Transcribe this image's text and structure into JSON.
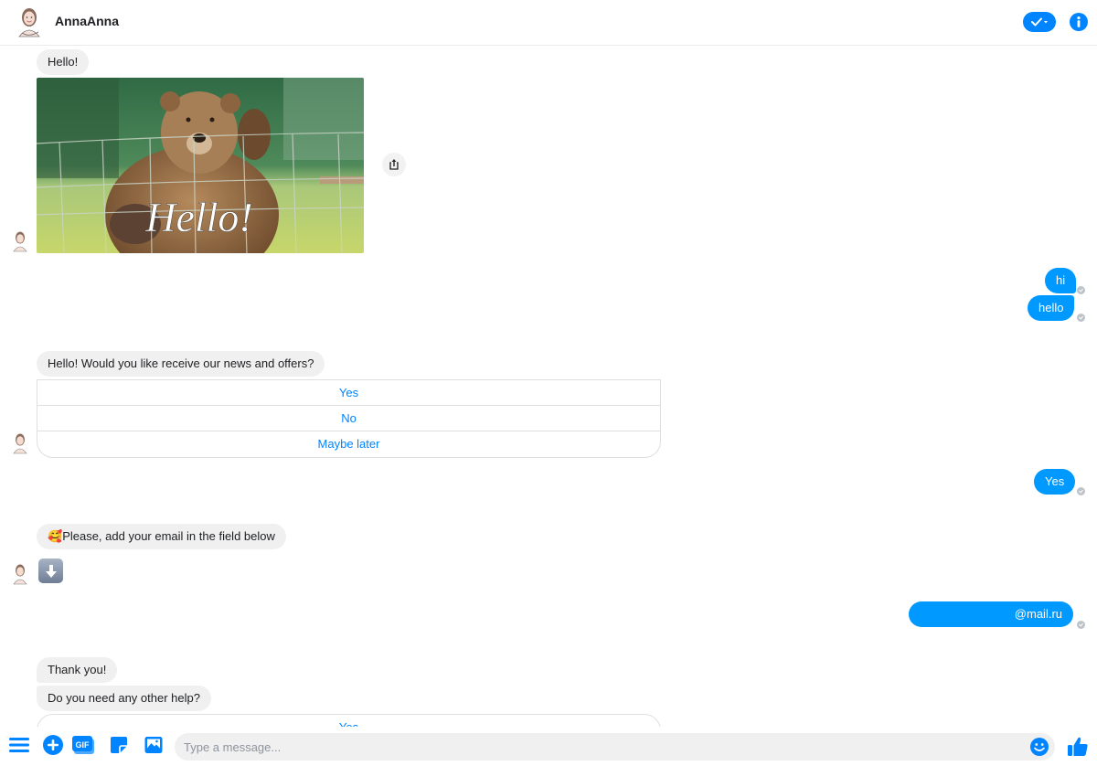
{
  "header": {
    "contact_name": "AnnaAnna"
  },
  "colors": {
    "accent": "#0084ff",
    "outgoing_bubble": "#0099ff",
    "incoming_bubble": "#f1f0f0",
    "seen_indicator": "#bec2c9"
  },
  "messages": {
    "greeting": "Hello!",
    "gif_caption": "Hello!",
    "out_hi": "hi",
    "out_hello": "hello",
    "question_news": "Hello! Would you like receive our news and offers?",
    "quick_replies_news": [
      {
        "label": "Yes"
      },
      {
        "label": "No"
      },
      {
        "label": "Maybe later"
      }
    ],
    "out_yes": "Yes",
    "email_prompt_emoji": "🥰",
    "email_prompt": "Please, add your email in the field below",
    "email_prompt_arrow": "⬇",
    "out_email": "@mail.ru",
    "thank_you": "Thank you!",
    "need_help": "Do you need any other help?",
    "quick_replies_help": [
      {
        "label": "Yes"
      }
    ]
  },
  "composer": {
    "placeholder": "Type a message...",
    "value": "",
    "gif_label": "GIF"
  }
}
